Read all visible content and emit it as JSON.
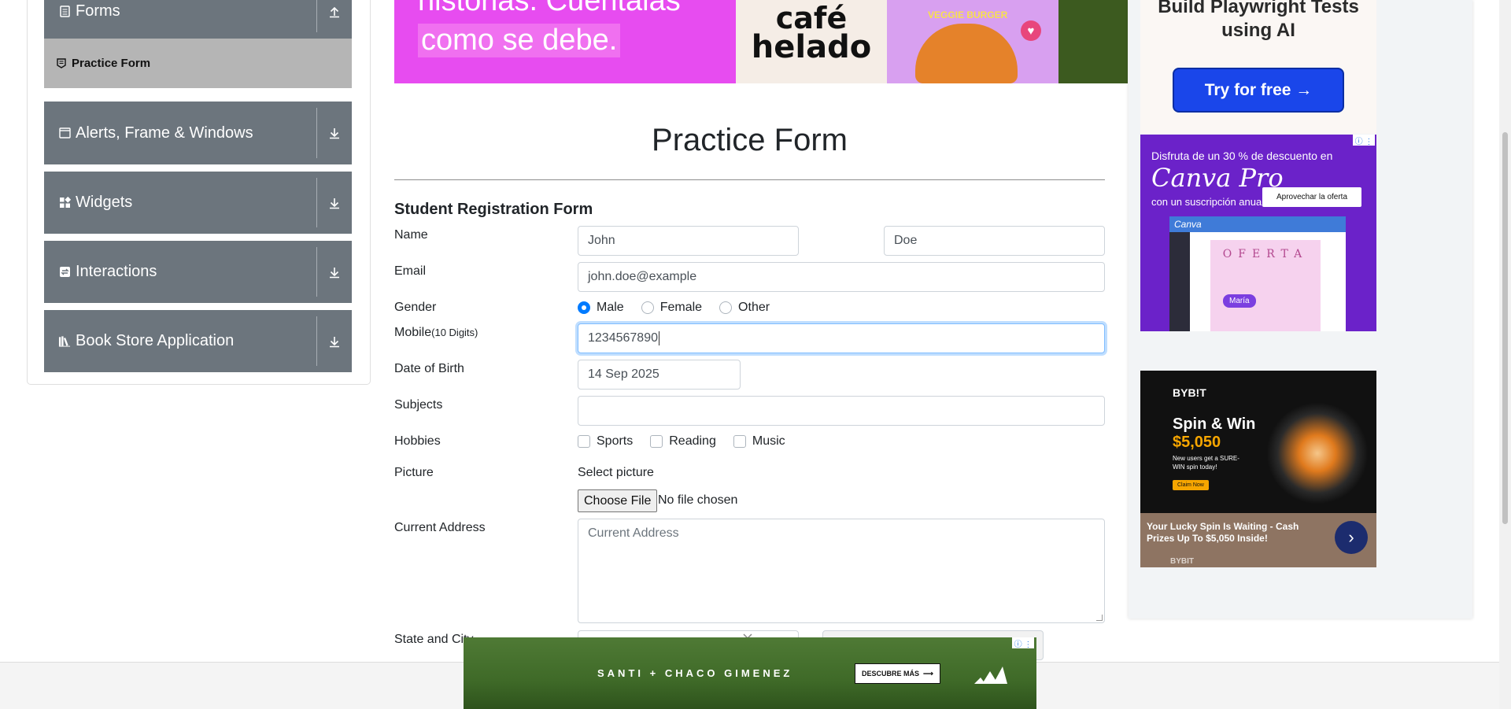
{
  "sidebar": {
    "forms_group": {
      "label": "Forms"
    },
    "forms_sub": {
      "label": "Practice Form"
    },
    "groups": [
      {
        "label": "Alerts, Frame & Windows"
      },
      {
        "label": "Widgets"
      },
      {
        "label": "Interactions"
      },
      {
        "label": "Book Store Application"
      }
    ]
  },
  "top_banner": {
    "line1": "historias. Cuéntalas",
    "line2": "como se debe.",
    "cafe1": "café",
    "cafe2": "helado",
    "veggie": "VEGGIE BURGER"
  },
  "main": {
    "page_title": "Practice Form",
    "form_title": "Student Registration Form",
    "labels": {
      "name": "Name",
      "email": "Email",
      "gender": "Gender",
      "mobile": "Mobile",
      "mobile_hint": "(10 Digits)",
      "dob": "Date of Birth",
      "subjects": "Subjects",
      "hobbies": "Hobbies",
      "picture": "Picture",
      "address": "Current Address",
      "state_city": "State and City"
    },
    "first_name": "John",
    "last_name": "Doe",
    "email": "john.doe@example",
    "genders": [
      {
        "label": "Male",
        "selected": true
      },
      {
        "label": "Female",
        "selected": false
      },
      {
        "label": "Other",
        "selected": false
      }
    ],
    "mobile": "1234567890",
    "dob": "14 Sep 2025",
    "subjects": "",
    "hobbies": [
      {
        "label": "Sports",
        "checked": false
      },
      {
        "label": "Reading",
        "checked": false
      },
      {
        "label": "Music",
        "checked": false
      }
    ],
    "picture_label": "Select picture",
    "file_button": "Choose File",
    "file_status": "No file chosen",
    "address_placeholder": "Current Address"
  },
  "ads": {
    "playwright": {
      "text": "Build Playwright Tests using AI",
      "button": "Try for free →"
    },
    "canva": {
      "line1": "Disfruta de un 30 % de descuento en",
      "brand": "Canva Pro",
      "line2": "con un suscripción anual",
      "cta": "Aprovechar la oferta",
      "screen_brand": "Canva",
      "card": "OFERTA",
      "name_tag": "María"
    },
    "bybit": {
      "logo": "BYB!T",
      "headline": "Spin & Win",
      "amount": "$5,050",
      "small": "New users get a SURE-WIN spin today!",
      "claim": "Claim Now",
      "footer": "Your Lucky Spin Is Waiting - Cash Prizes Up To $5,050 Inside!",
      "brand": "BYBIT"
    },
    "adidas": {
      "text": "SANTI + CHACO GIMENEZ",
      "cta": "DESCUBRE MÁS"
    }
  },
  "colors": {
    "sidebar_group": "#6c757d",
    "sidebar_active": "#b5b5b5",
    "accent": "#007bff"
  }
}
